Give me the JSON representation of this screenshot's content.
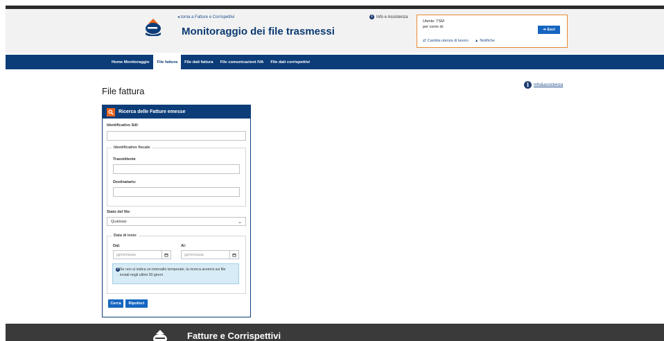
{
  "header": {
    "back_link": "torna a Fatture e Corrispettivi",
    "title": "Monitoraggio dei file trasmessi",
    "info_link": "Info e Assistenza",
    "user_line": "Utente: TSM",
    "on_behalf": "per conto di:",
    "exit_label": "Esci",
    "change_utility": "Cambia utenza di lavoro",
    "notifications": "Notifiche"
  },
  "nav": {
    "items": [
      {
        "label": "Home Monitoraggio"
      },
      {
        "label": "File fattura"
      },
      {
        "label": "File dati fattura"
      },
      {
        "label": "File comunicazioni IVA"
      },
      {
        "label": "File dati corrispettivi"
      }
    ],
    "active_index": 1
  },
  "help": {
    "label": "Info&assistenza"
  },
  "page": {
    "title": "File fattura"
  },
  "panel": {
    "title": "Ricerca delle Fatture emesse",
    "sdi_label": "Identificativo SdI:",
    "sdi_value": "",
    "fiscal_legend": "Identificativo fiscale",
    "sender_label": "Trasmittente",
    "sender_value": "",
    "recipient_label": "Destinatario:",
    "recipient_value": "",
    "status_label": "Stato del file:",
    "status_selected": "Qualsiasi",
    "date_legend": "Data di invio",
    "from_label": "Dal:",
    "to_label": "Al:",
    "date_placeholder": "gg/mm/aaaa",
    "alert_text": "Se non si indica un intervallo temporale, la ricerca avverrà sui file inviati negli ultimi 30 giorni",
    "search_button": "Cerca",
    "reset_button": "Ripulisci"
  },
  "footer": {
    "title": "Fatture e Corrispettivi"
  },
  "colors": {
    "brand_navy": "#0c3d78",
    "accent_orange": "#e8872f",
    "primary_blue": "#1565c0",
    "footer_dark": "#3a3a3a"
  },
  "icons": {
    "logo": "agenzia-entrate-logo",
    "search": "search-icon",
    "info": "info-icon",
    "calendar": "calendar-icon",
    "bell": "bell-icon",
    "swap": "swap-icon",
    "exit": "exit-icon",
    "chevron": "chevron-down-icon"
  }
}
